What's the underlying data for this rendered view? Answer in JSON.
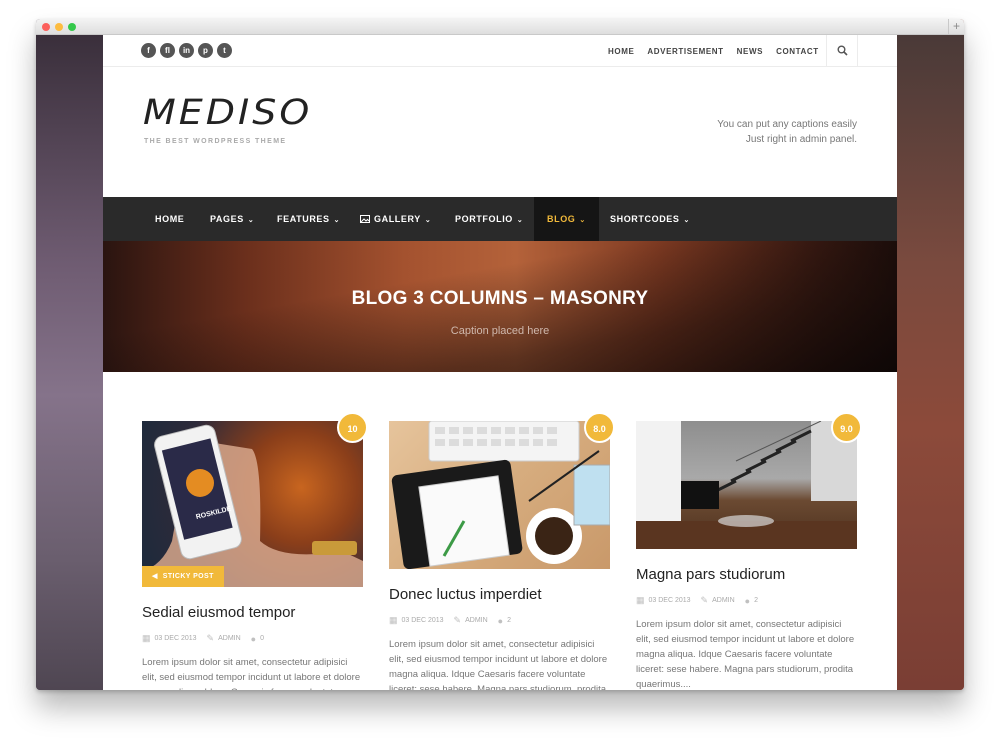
{
  "browser": {
    "new_tab": "+"
  },
  "social": [
    "f",
    "fl",
    "in",
    "p",
    "t"
  ],
  "social_icons": [
    "facebook-icon",
    "flickr-icon",
    "linkedin-icon",
    "pinterest-icon",
    "twitter-icon"
  ],
  "topnav": [
    "HOME",
    "ADVERTISEMENT",
    "NEWS",
    "CONTACT"
  ],
  "logo": "MEDISO",
  "tagline": "THE BEST WORDPRESS THEME",
  "header_caption": [
    "You can put any captions easily",
    "Just right in admin panel."
  ],
  "mainnav": [
    {
      "label": "HOME",
      "caret": ""
    },
    {
      "label": "PAGES",
      "caret": "⌄"
    },
    {
      "label": "FEATURES",
      "caret": "⌄"
    },
    {
      "label": "GALLERY",
      "caret": "⌄"
    },
    {
      "label": "PORTFOLIO",
      "caret": "⌄"
    },
    {
      "label": "BLOG",
      "caret": "⌄"
    },
    {
      "label": "SHORTCODES",
      "caret": "⌄"
    }
  ],
  "accent_color": "#f1b93a",
  "hero": {
    "title": "BLOG 3 COLUMNS – MASONRY",
    "caption": "Caption placed here"
  },
  "posts": [
    {
      "badge": "10",
      "sticky": "STICKY POST",
      "title": "Sedial eiusmod tempor",
      "date": "03 DEC 2013",
      "author": "ADMIN",
      "comments": "0",
      "excerpt": "Lorem ipsum dolor sit amet, consectetur adipisici elit, sed eiusmod tempor incidunt ut labore et dolore magna aliqua. Idque Caesaris facere voluntate liceret: sese habere. Magna pars"
    },
    {
      "badge": "8.0",
      "sticky": "",
      "title": "Donec luctus imperdiet",
      "date": "03 DEC 2013",
      "author": "ADMIN",
      "comments": "2",
      "excerpt": "Lorem ipsum dolor sit amet, consectetur adipisici elit, sed eiusmod tempor incidunt ut labore et dolore magna aliqua. Idque Caesaris facere voluntate liceret: sese habere. Magna pars studiorum, prodita quaerimus...."
    },
    {
      "badge": "9.0",
      "sticky": "",
      "title": "Magna pars studiorum",
      "date": "03 DEC 2013",
      "author": "ADMIN",
      "comments": "2",
      "excerpt": "Lorem ipsum dolor sit amet, consectetur adipisici elit, sed eiusmod tempor incidunt ut labore et dolore magna aliqua. Idque Caesaris facere voluntate liceret: sese habere. Magna pars studiorum, prodita quaerimus...."
    }
  ]
}
